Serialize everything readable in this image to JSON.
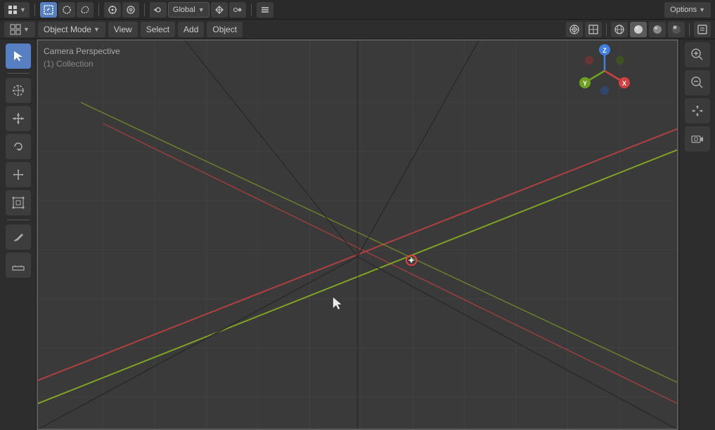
{
  "topToolbar": {
    "editorIcon": "↔",
    "selectModeIcons": [
      "□",
      "■",
      "◧",
      "▣",
      "⊡",
      "⊞",
      "⊟"
    ],
    "snapIcon": "⊕",
    "proportionalIcon": "◎",
    "globalLabel": "Global",
    "transformLabel": "⇄",
    "snapPivotIcon": "◐",
    "optionsLabel": "Options"
  },
  "headerBar": {
    "objectModeLabel": "Object Mode",
    "viewLabel": "View",
    "selectLabel": "Select",
    "addLabel": "Add",
    "objectLabel": "Object",
    "rightIcons": [
      "👁",
      "🔲",
      "○",
      "●",
      "🌐",
      "□",
      "⚙"
    ]
  },
  "viewport": {
    "perspectiveLabel": "Camera Perspective",
    "collectionLabel": "(1) Collection"
  },
  "leftSidebar": {
    "tools": [
      {
        "name": "select",
        "icon": "↖",
        "active": true
      },
      {
        "name": "cursor",
        "icon": "⊕"
      },
      {
        "name": "move",
        "icon": "✛"
      },
      {
        "name": "rotate",
        "icon": "↻"
      },
      {
        "name": "scale",
        "icon": "⤢"
      },
      {
        "name": "transform",
        "icon": "⊞"
      },
      {
        "name": "annotate",
        "icon": "✏"
      },
      {
        "name": "measure",
        "icon": "📏"
      }
    ]
  },
  "gizmo": {
    "xColor": "#e04040",
    "yColor": "#80b040",
    "zColor": "#4080e0",
    "xLabel": "X",
    "yLabel": "Y",
    "zLabel": "Z"
  },
  "rightNav": {
    "buttons": [
      {
        "name": "zoom-in",
        "icon": "🔍+"
      },
      {
        "name": "zoom-out",
        "icon": "🔍-"
      },
      {
        "name": "pan",
        "icon": "✋"
      },
      {
        "name": "camera",
        "icon": "🎥"
      }
    ]
  }
}
